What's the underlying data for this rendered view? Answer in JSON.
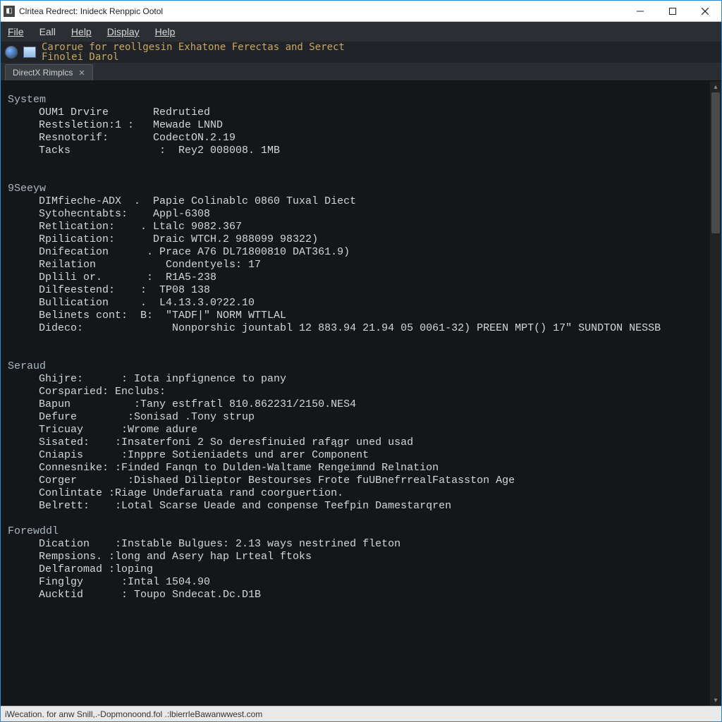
{
  "window": {
    "title": "Clritea Redrect: Inideck Renppic Ootol"
  },
  "menubar": [
    "File",
    "Eall",
    "Help",
    "Display",
    "Help"
  ],
  "toolbar": {
    "line1": "Carorue for reollgesin Exhatone Ferectas and Serect",
    "line2": "Finolei Darol"
  },
  "tab": {
    "label": "DirectX Rimplcs"
  },
  "sections": {
    "system": {
      "title": "System",
      "rows": [
        {
          "k": "OUM1 Drvire",
          "sep": "     ",
          "v": "Redrutied"
        },
        {
          "k": "Restsletion:1",
          "sep": " :   ",
          "v": "Mewade LNND"
        },
        {
          "k": "Resnotorif:",
          "sep": "     ",
          "v": "CodectON.2.19"
        },
        {
          "k": "Tacks",
          "sep": "      :  ",
          "v": "Rey2 008008. 1MB"
        }
      ]
    },
    "sesew": {
      "title": "9Seeyw",
      "rows": [
        {
          "k": "DIMfieche-ADX",
          "sep": "  .  ",
          "v": "Papie Colinablc 0860 Tuxal Diect"
        },
        {
          "k": "Sytohecntabts:",
          "sep": "    ",
          "v": "Appl-6308"
        },
        {
          "k": "Retlication:",
          "sep": "   . ",
          "v": "Ltalc 9082.367"
        },
        {
          "k": "Rpilication:",
          "sep": "     ",
          "v": "Draic WTCH.2 988099 98322)"
        },
        {
          "k": "Dnifecation",
          "sep": "    . ",
          "v": "Prace A76 DL71800810 DAT361.9)"
        },
        {
          "k": "Reilation",
          "sep": "       ",
          "v": "Condentyels: 17"
        },
        {
          "k": "Dplili or.",
          "sep": "    :  ",
          "v": "R1A5-238"
        },
        {
          "k": "Dilfeestend:",
          "sep": "   :  ",
          "v": "TP08 138"
        },
        {
          "k": "Bullication",
          "sep": "   .  ",
          "v": "L4.13.3.0?22.10"
        },
        {
          "k": "Belinets cont:",
          "sep": "  B:  ",
          "v": "\"TADF|\" NORM WTTLAL"
        },
        {
          "k": "Dideco:",
          "sep": "        ",
          "v": "Nonporshic jountabl 12 883.94 21.94 05 0061-32) PREEN MPT() 17\" SUNDTON NESSB"
        }
      ]
    },
    "seraud": {
      "title": "Seraud",
      "rows": [
        {
          "k": "Ghijre:",
          "sep": "   : ",
          "v": "Iota inpfignence to pany"
        },
        {
          "k": "Corsparied:",
          "sep": " ",
          "v": "Enclubs:"
        },
        {
          "k": "Bapun",
          "sep": "     :",
          "v": "Tany estfratl 810.862231/2150.NES4"
        },
        {
          "k": "Defure",
          "sep": "    :",
          "v": "Sonisad .Tony strup"
        },
        {
          "k": "Tricuay",
          "sep": "   :",
          "v": "Wrome adure"
        },
        {
          "k": "Sisated:",
          "sep": "  :",
          "v": "Insaterfoni 2 So deresfinuied rafągr uned usad"
        },
        {
          "k": "Cniapis",
          "sep": "   :",
          "v": "Inppre Sotieniadets und arer Component"
        },
        {
          "k": "Connesnike:",
          "sep": " :",
          "v": "Finded Fanqn to Dulden-Waltame Rengeimnd Relnation"
        },
        {
          "k": "Corger",
          "sep": "    :",
          "v": "Dishaed Dilieptor Bestourses Frote fuUBnefrrealFatasston Age"
        },
        {
          "k": "Conlintate",
          "sep": " :",
          "v": "Riage Undefaruata rand coorguertion."
        },
        {
          "k": "Belrett:",
          "sep": "  :",
          "v": "Lotal Scarse Ueade and conpense Teefpin Damestarqren"
        }
      ]
    },
    "foreweddl": {
      "title": "Forewddl",
      "rows": [
        {
          "k": "Dication",
          "sep": "  :",
          "v": "Instable Bulgues: 2.13 ways nestrined fleton"
        },
        {
          "k": "Rempsions.",
          "sep": " :",
          "v": "long and Asery hap Lrteal ftoks"
        },
        {
          "k": "Delfaromad",
          "sep": " :",
          "v": "loping"
        },
        {
          "k": "Finglgy",
          "sep": "   :",
          "v": "Intal 1504.90"
        },
        {
          "k": "Aucktid",
          "sep": "   : ",
          "v": "Toupo Sndecat.Dc.D1B"
        }
      ]
    }
  },
  "statusbar": "iWecation. for anw Snill,.-Dopmonoond.fol .:lbierrleBawanwwest.com"
}
